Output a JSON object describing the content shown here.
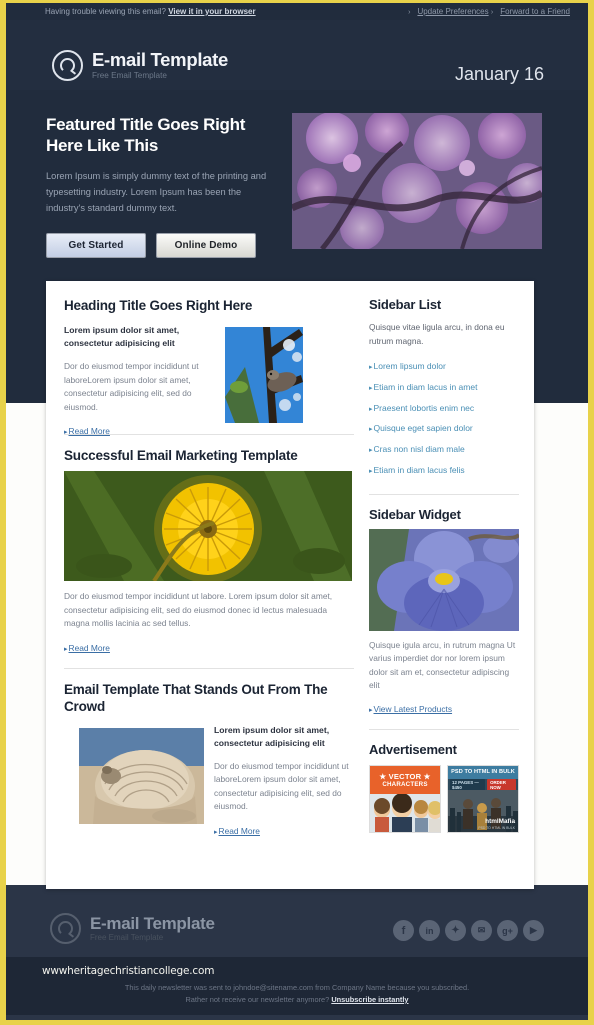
{
  "preheader": {
    "trouble_text": "Having trouble viewing this email?",
    "browser_link": "View it in your browser",
    "update_prefs": "Update Preferences",
    "forward": "Forward to a Friend"
  },
  "header": {
    "logo_title": "E-mail Template",
    "logo_subtitle": "Free Email Template",
    "date": "January 16"
  },
  "hero": {
    "title": "Featured Title Goes Right Here Like This",
    "body": "Lorem Ipsum is simply dummy text of the printing and typesetting industry. Lorem Ipsum has been the industry's standard dummy text.",
    "primary_button": "Get Started",
    "secondary_button": "Online Demo"
  },
  "articles": [
    {
      "heading": "Heading Title Goes Right Here",
      "lead": "Lorem ipsum dolor sit amet, consectetur adipisicing elit",
      "body": "Dor do eiusmod tempor incididunt ut laboreLorem ipsum dolor sit amet, consectetur adipisicing elit, sed do eiusmod.",
      "link": "Read More"
    },
    {
      "heading": "Successful Email Marketing Template",
      "body": "Dor do eiusmod tempor incididunt ut labore. Lorem ipsum dolor sit amet, consectetur adipisicing elit, sed do eiusmod donec id lectus malesuada magna mollis lacinia ac sed tellus.",
      "link": "Read More"
    },
    {
      "heading": "Email Template That Stands Out From The Crowd",
      "lead": "Lorem ipsum dolor sit amet, consectetur adipisicing elit",
      "body": "Dor do eiusmod tempor incididunt ut laboreLorem ipsum dolor sit amet, consectetur adipisicing elit, sed do eiusmod.",
      "link": "Read More"
    }
  ],
  "sidebar": {
    "list_title": "Sidebar List",
    "list_intro": "Quisque vitae ligula arcu, in dona eu rutrum magna.",
    "list_items": [
      "Lorem lipsum dolor",
      "Etiam in diam lacus in amet",
      "Praesent lobortis enim nec",
      "Quisque eget sapien dolor",
      "Cras non nisl diam male",
      "Etiam in diam lacus felis"
    ],
    "widget_title": "Sidebar Widget",
    "widget_body": "Quisque igula arcu, in rutrum magna Ut varius imperdiet dor nor lorem ipsum dolor sit am et, consectetur adipiscing elit",
    "widget_link": "View Latest Products",
    "ad_title": "Advertisement",
    "ads": [
      {
        "line1": "★ VECTOR ★",
        "line2": "CHARACTERS"
      },
      {
        "headline": "PSD TO HTML IN BULK",
        "pill": "12 PAGES — $450",
        "cta": "ORDER NOW",
        "brand": "htmlMafia",
        "brand_sub": "PSD TO HTML IN BULK"
      }
    ]
  },
  "footer": {
    "logo_title": "E-mail Template",
    "logo_subtitle": "Free Email Template",
    "social_icons": [
      "facebook-icon",
      "linkedin-icon",
      "twitter-icon",
      "email-icon",
      "google-plus-icon",
      "youtube-icon"
    ],
    "site_url": "wwwheritagechristiancollege.com",
    "fine_line1": "This daily newsletter was sent to johndoe@sitename.com from Company Name because you subscribed.",
    "fine_line2_prefix": "Rather not receive our newsletter anymore?",
    "unsubscribe": "Unsubscribe instantly"
  },
  "colors": {
    "frame": "#e8d24a",
    "dark_navy": "#212c3d",
    "footer_navy": "#2b3547",
    "link_blue": "#3a6ea5",
    "sidebar_link": "#4a8fb5"
  }
}
